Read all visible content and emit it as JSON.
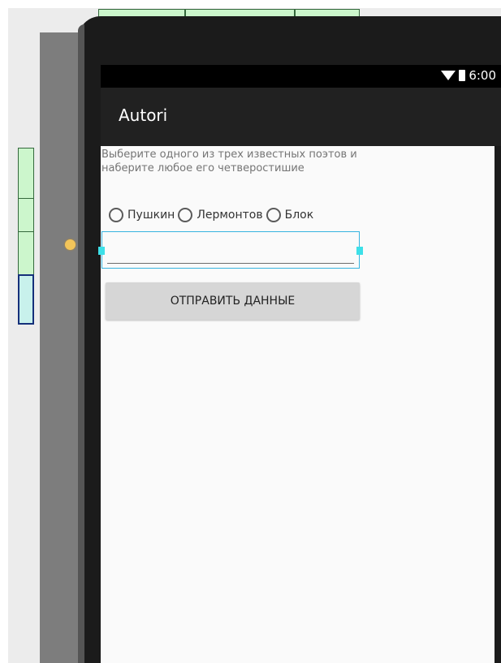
{
  "status_bar": {
    "time": "6:00",
    "wifi_icon": "wifi-icon",
    "battery_icon": "battery-icon"
  },
  "app_bar": {
    "title": "Autori"
  },
  "content": {
    "instruction": "Выберите одного из трех известных поэтов и наберите любое его четверостишие",
    "radios": [
      {
        "label": "Пушкин",
        "checked": false
      },
      {
        "label": "Лермонтов",
        "checked": false
      },
      {
        "label": "Блок",
        "checked": false
      }
    ],
    "input": {
      "value": "",
      "placeholder": ""
    },
    "submit_label": "ОТПРАВИТЬ ДАННЫЕ"
  },
  "colors": {
    "app_bar": "#212121",
    "status_bar": "#000000",
    "content_bg": "#fafafa",
    "selection_border": "#36b4e0",
    "button_bg": "#d6d6d6",
    "guide_fill": "#ccf6cc"
  }
}
